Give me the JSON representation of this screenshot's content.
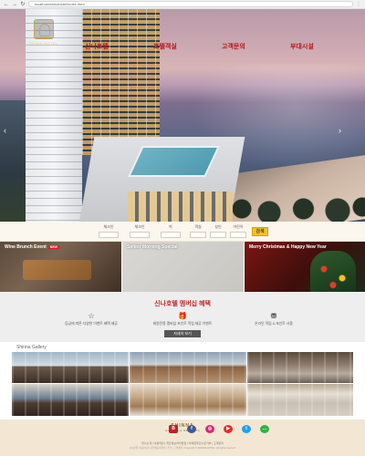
{
  "browser": {
    "url": "localhost/shinahotel/index.html",
    "back_glyph": "←",
    "forward_glyph": "→",
    "reload_glyph": "↻",
    "menu_glyph": "⋮"
  },
  "logo": {
    "text": "SHINA HOTEL"
  },
  "nav": {
    "items": [
      {
        "label": "신나호텔"
      },
      {
        "label": "호텔객실"
      },
      {
        "label": "고객문의"
      },
      {
        "label": "부대시설"
      }
    ]
  },
  "hero": {
    "prev_glyph": "‹",
    "next_glyph": "›"
  },
  "booking": {
    "fields": [
      {
        "label": "체크인",
        "value": ""
      },
      {
        "label": "체크인",
        "value": ""
      },
      {
        "label": "박",
        "value": ""
      },
      {
        "label": "객실",
        "value": ""
      },
      {
        "label": "성인",
        "value": ""
      },
      {
        "label": "어린이",
        "value": ""
      }
    ],
    "search_label": "검색"
  },
  "promos": [
    {
      "title": "Wine Brunch Event",
      "badge": "NEW"
    },
    {
      "title": "Senior Morning Special",
      "badge": ""
    },
    {
      "title": "Merry Christmas & Happy New Year",
      "badge": ""
    }
  ],
  "membership": {
    "title": "신나호텔 멤버십 혜택",
    "benefits": [
      {
        "icon": "star-icon",
        "glyph": "☆",
        "text": "등급에 따른 다양한 이벤트 혜택 제공"
      },
      {
        "icon": "gift-icon",
        "glyph": "🎁",
        "text": "회원전용 멤버십 포인트 적립 제공 이벤트"
      },
      {
        "icon": "coin-icon",
        "glyph": "⛃",
        "text": "온라인 적립 & 포인트 사용"
      }
    ],
    "button_label": "자세히 보기"
  },
  "gallery": {
    "title": "Shinna Gallery"
  },
  "footer": {
    "logo_name": "SHINNA",
    "logo_sub": "HOTELS & RESORTS",
    "socials": [
      {
        "icon": "blog-icon",
        "glyph": "B",
        "color": "#b3262b"
      },
      {
        "icon": "facebook-icon",
        "glyph": "f",
        "color": "#3b5998"
      },
      {
        "icon": "instagram-icon",
        "glyph": "◎",
        "color": "#d62976"
      },
      {
        "icon": "youtube-icon",
        "glyph": "▶",
        "color": "#e52d27"
      },
      {
        "icon": "twitter-icon",
        "glyph": "t",
        "color": "#1da1f2"
      },
      {
        "icon": "chat-icon",
        "glyph": "…",
        "color": "#2fb344"
      }
    ],
    "links": "회사소개 | 이용약관 | 개인정보처리방침 | 이메일무단수집거부 | 고객문의",
    "info": "신나호텔 | 대표이사 | 사업자등록번호 | 주소 | 고객센터 | Copyright © SHINNA HOTEL. All rights reserved."
  },
  "colors": {
    "accent_red": "#c0272d",
    "search_yellow": "#f5c22a",
    "footer_beige": "#f3e7d3"
  }
}
